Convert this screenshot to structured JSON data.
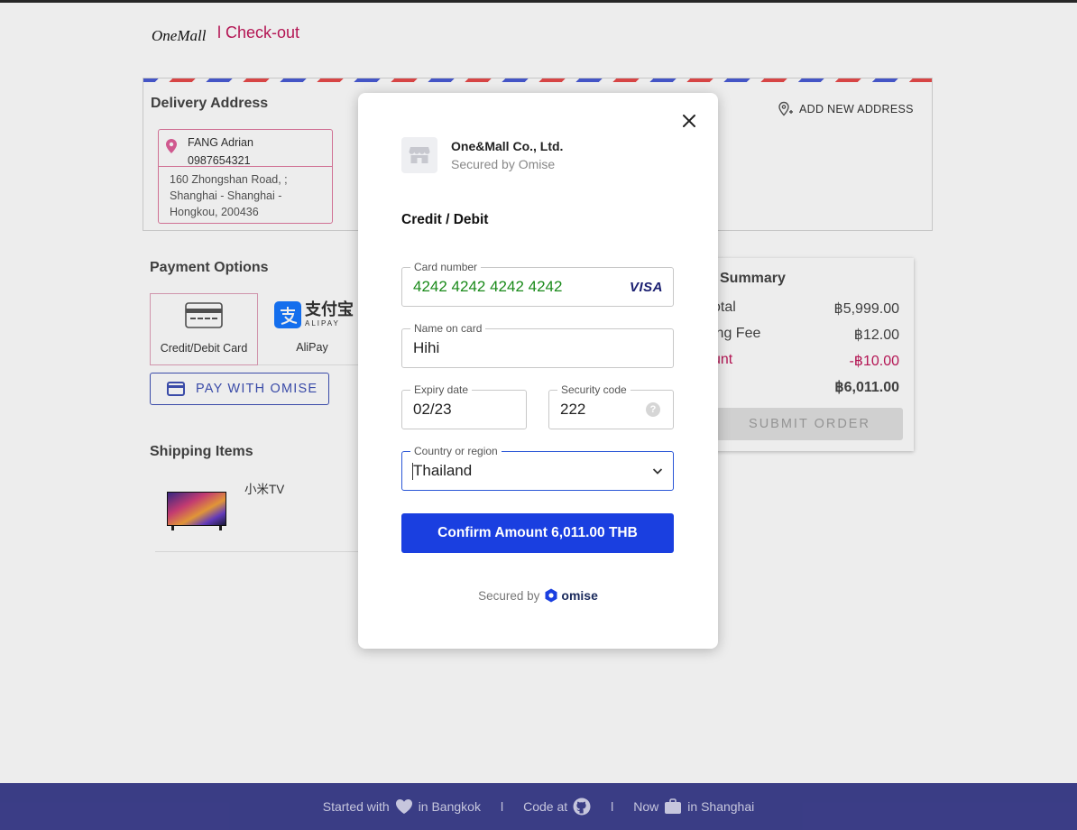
{
  "header": {
    "logo": "OneMall",
    "title": "l Check-out"
  },
  "delivery": {
    "title": "Delivery Address",
    "add_new_label": "ADD NEW ADDRESS",
    "address": {
      "name": "FANG Adrian",
      "phone": "0987654321",
      "street": "160 Zhongshan Road, ; Shanghai - Shanghai - Hongkou, 200436"
    }
  },
  "payment": {
    "title": "Payment Options",
    "options": [
      {
        "label": "Credit/Debit Card",
        "icon": "credit-card-icon",
        "selected": true
      },
      {
        "label": "AliPay",
        "icon": "alipay-logo",
        "logo_text": "支付宝",
        "logo_sub": "ALIPAY"
      }
    ],
    "omise_button": "PAY WITH OMISE"
  },
  "shipping": {
    "title": "Shipping Items",
    "items": [
      {
        "name": "小米TV",
        "thumbnail": "tv-image"
      }
    ]
  },
  "summary": {
    "title": "Summary",
    "rows": [
      {
        "key": "otal",
        "value": "฿5,999.00"
      },
      {
        "key": "ing Fee",
        "value": "฿12.00"
      },
      {
        "key": "unt",
        "value": "-฿10.00"
      },
      {
        "key": "",
        "value": "฿6,011.00"
      }
    ],
    "submit_label": "SUBMIT ORDER"
  },
  "modal": {
    "merchant_name": "One&Mall Co., Ltd.",
    "merchant_sub": "Secured by Omise",
    "method_title": "Credit / Debit",
    "fields": {
      "card_number": {
        "label": "Card number",
        "value": "4242 4242 4242 4242",
        "brand": "VISA"
      },
      "name_on_card": {
        "label": "Name on card",
        "value": "Hihi"
      },
      "expiry": {
        "label": "Expiry date",
        "value": "02/23"
      },
      "security_code": {
        "label": "Security code",
        "value": "222"
      },
      "country": {
        "label": "Country or region",
        "value": "Thailand"
      }
    },
    "confirm_label": "Confirm Amount 6,011.00 THB",
    "secured_by": "Secured by",
    "omise_brand": "omise"
  },
  "footer": {
    "started_with": "Started with",
    "in_bangkok": "in Bangkok",
    "code_at": "Code at",
    "now": "Now",
    "in_shanghai": "in Shanghai",
    "separator": "l"
  },
  "colors": {
    "accent_pink": "#c2185b",
    "primary_blue": "#1a3fe0",
    "footer_bg": "#3f4290",
    "card_number_green": "#1a8a1a"
  }
}
